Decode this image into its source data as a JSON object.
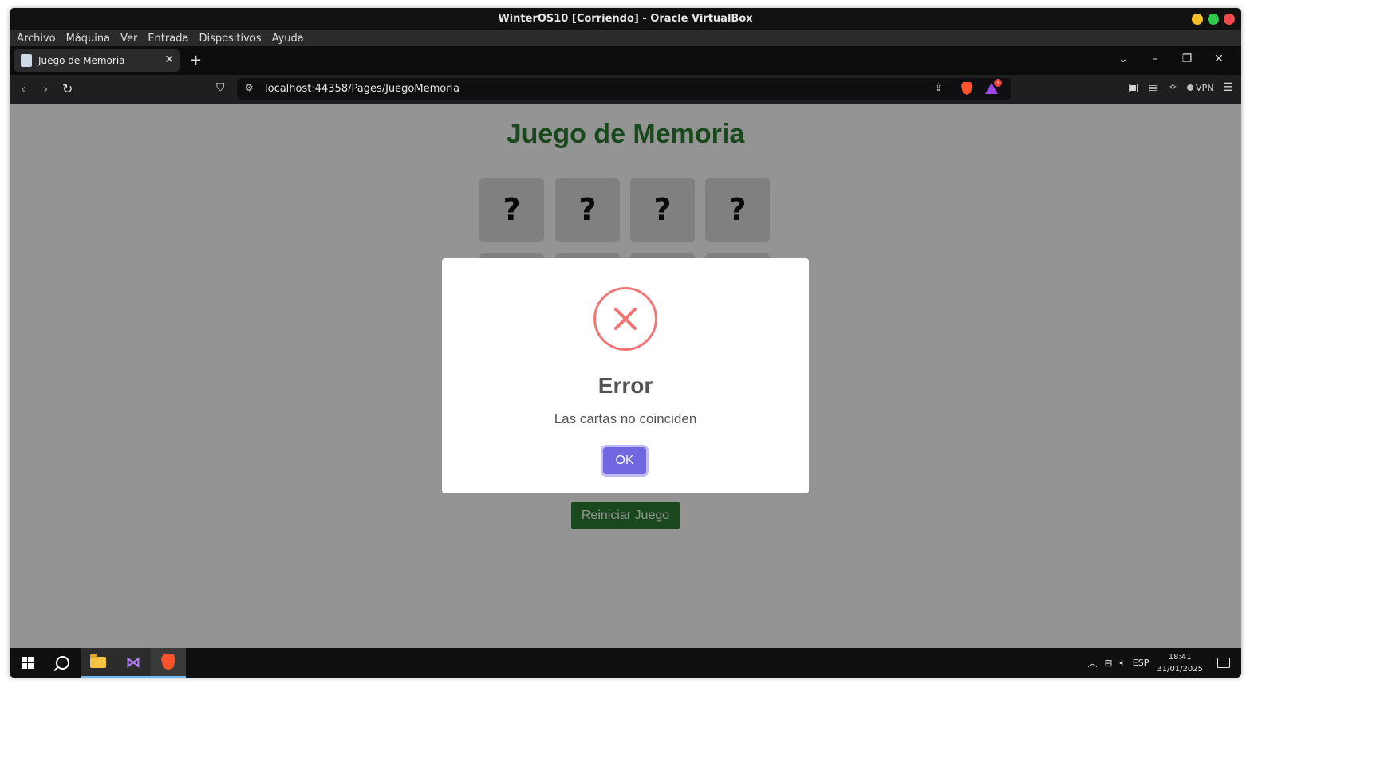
{
  "window": {
    "title": "WinterOS10 [Corriendo] - Oracle VirtualBox",
    "traffic_colors": [
      "#f5c026",
      "#2fc84a",
      "#f24b4b"
    ]
  },
  "vbox_menu": [
    "Archivo",
    "Máquina",
    "Ver",
    "Entrada",
    "Dispositivos",
    "Ayuda"
  ],
  "browser": {
    "tab_title": "Juego de Memoria",
    "url": "localhost:44358/Pages/JuegoMemoria",
    "vpn_label": "VPN",
    "rewards_badge": "1"
  },
  "page": {
    "heading": "Juego de Memoria",
    "card_symbol": "?",
    "cards_visible_row": [
      "?",
      "?",
      "?",
      "?"
    ],
    "restart_label": "Reiniciar Juego",
    "accent_color": "#2e7d32"
  },
  "dialog": {
    "title": "Error",
    "message": "Las cartas no coinciden",
    "confirm_label": "OK",
    "icon": "error-x-icon",
    "icon_color": "#f27474",
    "button_color": "#7066e0"
  },
  "taskbar": {
    "apps": [
      "windows-start-icon",
      "search-icon",
      "file-explorer-icon",
      "visual-studio-icon",
      "brave-browser-icon"
    ],
    "language": "ESP",
    "time": "18:41",
    "date": "31/01/2025"
  }
}
